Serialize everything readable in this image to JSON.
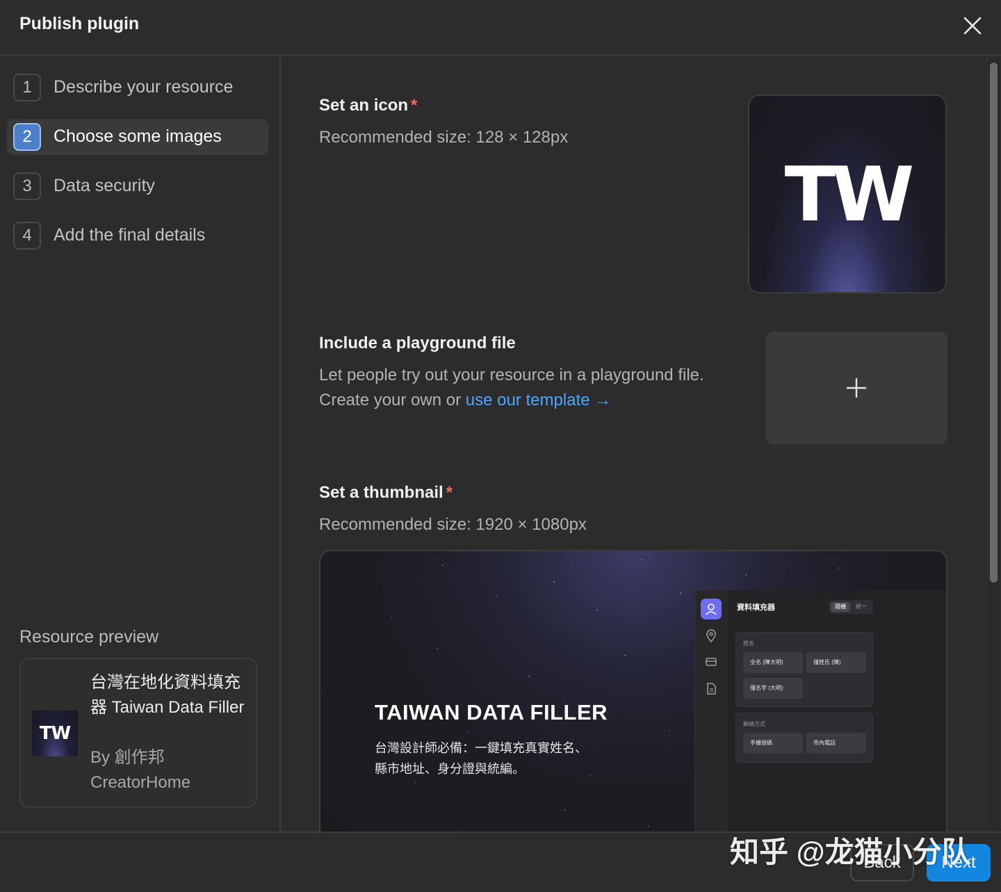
{
  "header": {
    "title": "Publish plugin"
  },
  "steps": [
    {
      "number": "1",
      "label": "Describe your resource",
      "active": false
    },
    {
      "number": "2",
      "label": "Choose some images",
      "active": true
    },
    {
      "number": "3",
      "label": "Data security",
      "active": false
    },
    {
      "number": "4",
      "label": "Add the final details",
      "active": false
    }
  ],
  "preview": {
    "title": "Resource preview",
    "icon_text": "TW",
    "name": "台灣在地化資料填充器 Taiwan Data Filler",
    "by": "By 創作邦 CreatorHome"
  },
  "icon_section": {
    "title": "Set an icon",
    "required_mark": "*",
    "subtitle": "Recommended size: 128 × 128px",
    "image_text": "TW"
  },
  "playground_section": {
    "title": "Include a playground file",
    "line1": "Let people try out your resource in a playground file.",
    "line2_prefix": "Create your own or ",
    "link": "use our template →",
    "add_symbol": "+"
  },
  "thumbnail_section": {
    "title": "Set a thumbnail",
    "required_mark": "*",
    "subtitle": "Recommended size: 1920 × 1080px",
    "image": {
      "headline": "TAIWAN DATA FILLER",
      "desc_line1": "台灣設計師必備：一鍵填充真實姓名、",
      "desc_line2": "縣市地址、身分證與統編。",
      "mock": {
        "title": "資料填充器",
        "tab_on": "隨機",
        "tab_off": "統一",
        "group1_label": "姓名",
        "chip1": "全名 (陳大明)",
        "chip2": "僅姓氏 (陳)",
        "chip3": "僅名字 (大明)",
        "group2_label": "聯絡方式",
        "chip4": "手機號碼",
        "chip5": "市內電話"
      }
    }
  },
  "footer": {
    "back": "Back",
    "next": "Next"
  },
  "watermark": "知乎 @龙猫小分队",
  "colors": {
    "accent": "#1486e0",
    "link": "#4ea5ff",
    "required": "#f26a5a",
    "active_step": "#4d7fc8"
  }
}
